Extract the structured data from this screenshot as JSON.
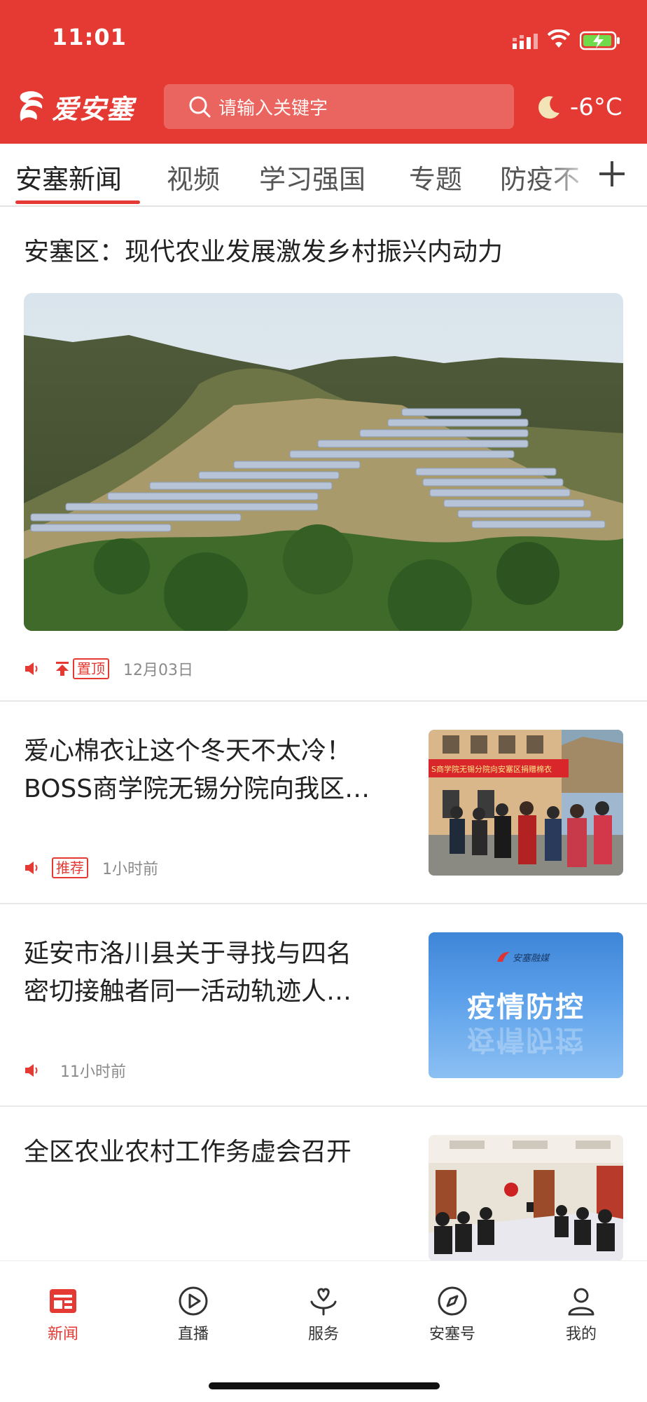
{
  "status_bar": {
    "time": "11:01"
  },
  "header": {
    "logo_text": "爱安塞",
    "search_placeholder": "请输入关键字",
    "temperature": "-6°C",
    "brand_color": "#e53a33"
  },
  "tabs": [
    {
      "label": "安塞新闻",
      "active": true
    },
    {
      "label": "视频"
    },
    {
      "label": "学习强国"
    },
    {
      "label": "专题"
    },
    {
      "label": "防疫不"
    }
  ],
  "articles": [
    {
      "title": "安塞区：现代农业发展激发乡村振兴内动力",
      "badge": "置顶",
      "time": "12月03日"
    },
    {
      "title_line1": "爱心棉衣让这个冬天不太冷！",
      "title_line2": "BOSS商学院无锡分院向我区…",
      "badge": "推荐",
      "time": "1小时前",
      "thumb_banner": "S商学院无锡分院向安塞区捐赠棉衣"
    },
    {
      "title_line1": "延安市洛川县关于寻找与四名",
      "title_line2": "密切接触者同一活动轨迹人…",
      "time": "11小时前",
      "thumb_brand": "安塞融媒",
      "thumb_text": "疫情防控"
    },
    {
      "title": "全区农业农村工作务虚会召开"
    }
  ],
  "bottom_nav": [
    {
      "label": "新闻",
      "icon": "news-icon",
      "active": true
    },
    {
      "label": "直播",
      "icon": "play-icon"
    },
    {
      "label": "服务",
      "icon": "heart-hand-icon"
    },
    {
      "label": "安塞号",
      "icon": "compass-icon"
    },
    {
      "label": "我的",
      "icon": "user-icon"
    }
  ]
}
